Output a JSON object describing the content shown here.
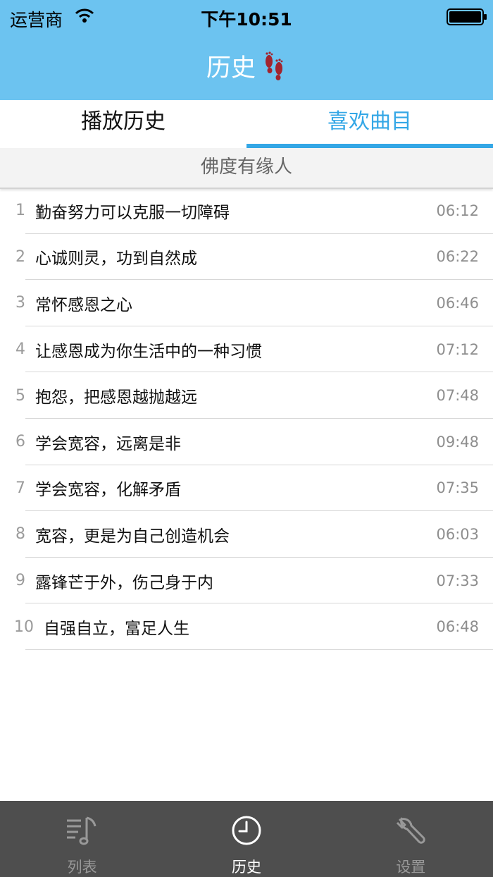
{
  "status_bar": {
    "carrier": "运营商",
    "time": "下午10:51"
  },
  "nav": {
    "title": "历史"
  },
  "tabs": [
    {
      "label": "播放历史",
      "active": false
    },
    {
      "label": "喜欢曲目",
      "active": true
    }
  ],
  "section": {
    "title": "佛度有缘人"
  },
  "items": [
    {
      "index": "1",
      "title": "勤奋努力可以克服一切障碍",
      "duration": "06:12"
    },
    {
      "index": "2",
      "title": "心诚则灵，功到自然成",
      "duration": "06:22"
    },
    {
      "index": "3",
      "title": "常怀感恩之心",
      "duration": "06:46"
    },
    {
      "index": "4",
      "title": "让感恩成为你生活中的一种习惯",
      "duration": "07:12"
    },
    {
      "index": "5",
      "title": "抱怨，把感恩越抛越远",
      "duration": "07:48"
    },
    {
      "index": "6",
      "title": "学会宽容，远离是非",
      "duration": "09:48"
    },
    {
      "index": "7",
      "title": "学会宽容，化解矛盾",
      "duration": "07:35"
    },
    {
      "index": "8",
      "title": "宽容，更是为自己创造机会",
      "duration": "06:03"
    },
    {
      "index": "9",
      "title": "露锋芒于外，伤己身于内",
      "duration": "07:33"
    },
    {
      "index": "10",
      "title": "自强自立，富足人生",
      "duration": "06:48"
    }
  ],
  "tabbar": [
    {
      "label": "列表",
      "icon": "music-list-icon",
      "active": false
    },
    {
      "label": "历史",
      "icon": "clock-icon",
      "active": true
    },
    {
      "label": "设置",
      "icon": "wrench-icon",
      "active": false
    }
  ],
  "colors": {
    "header": "#6cc3f0",
    "accent": "#34a7e6",
    "tabbar": "#4e4e4e"
  }
}
